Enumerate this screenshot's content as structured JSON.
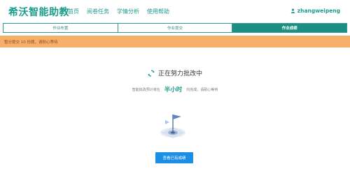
{
  "app": {
    "title": "希沃智能助教"
  },
  "nav": {
    "items": [
      "首页",
      "阅卷任务",
      "学情分析",
      "使用帮助"
    ]
  },
  "user": {
    "name": "zhangweipeng",
    "icon": "user-icon"
  },
  "tabs": [
    {
      "label": "作业布置",
      "active": false
    },
    {
      "label": "作业提交",
      "active": false
    },
    {
      "label": "作业成绩",
      "active": true
    }
  ],
  "alert": {
    "text": "暂分提交 10 份题，请耐心等待"
  },
  "status": {
    "text": "正在努力批改中",
    "icon": "sync-icon"
  },
  "info": {
    "prefix": "智能批改预计将在",
    "highlight": "半小时",
    "suffix": "内完成，请耐心等待"
  },
  "illustration": {
    "icon": "grading-flag-illustration"
  },
  "button": {
    "label": "查看已有成绩"
  },
  "colors": {
    "brand": "#1a9c8c",
    "alert_bg": "#f6b06a",
    "button": "#1b8ee6"
  }
}
